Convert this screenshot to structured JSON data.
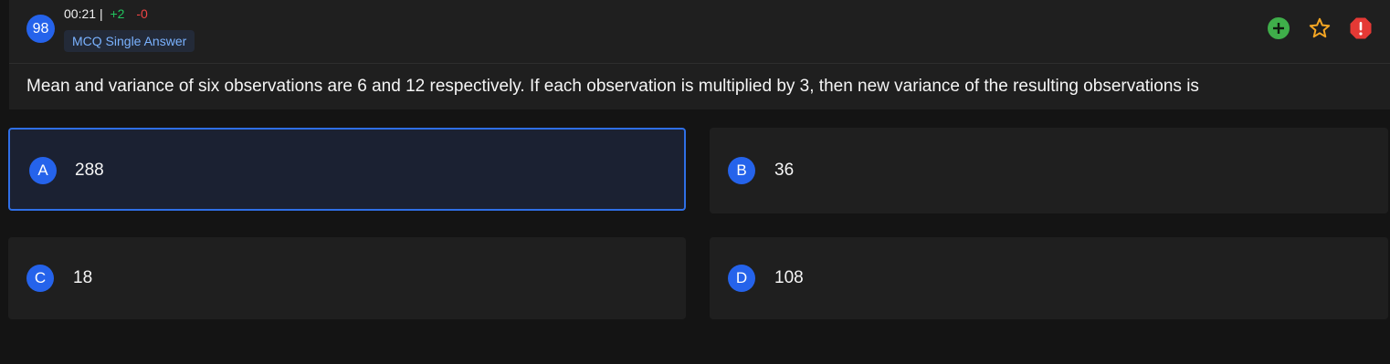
{
  "question": {
    "number": "98",
    "timer": "00:21",
    "separator": "|",
    "marks_positive": "+2",
    "marks_negative": "-0",
    "type": "MCQ Single Answer",
    "text": "Mean and variance of six observations are 6 and 12 respectively. If each observation is multiplied by 3, then new variance of the resulting observations is"
  },
  "actions": {
    "add_icon": "plus-circle-icon",
    "bookmark_icon": "star-outline-icon",
    "report_icon": "alert-octagon-icon",
    "colors": {
      "add": "#3fae4a",
      "bookmark": "#f5a623",
      "report": "#e53935"
    }
  },
  "options": [
    {
      "letter": "A",
      "value": "288",
      "selected": true
    },
    {
      "letter": "B",
      "value": "36",
      "selected": false
    },
    {
      "letter": "C",
      "value": "18",
      "selected": false
    },
    {
      "letter": "D",
      "value": "108",
      "selected": false
    }
  ],
  "colors": {
    "accent": "#2563eb",
    "selected_border": "#2f6fe6",
    "background": "#141414",
    "card": "#1f1f1f"
  }
}
